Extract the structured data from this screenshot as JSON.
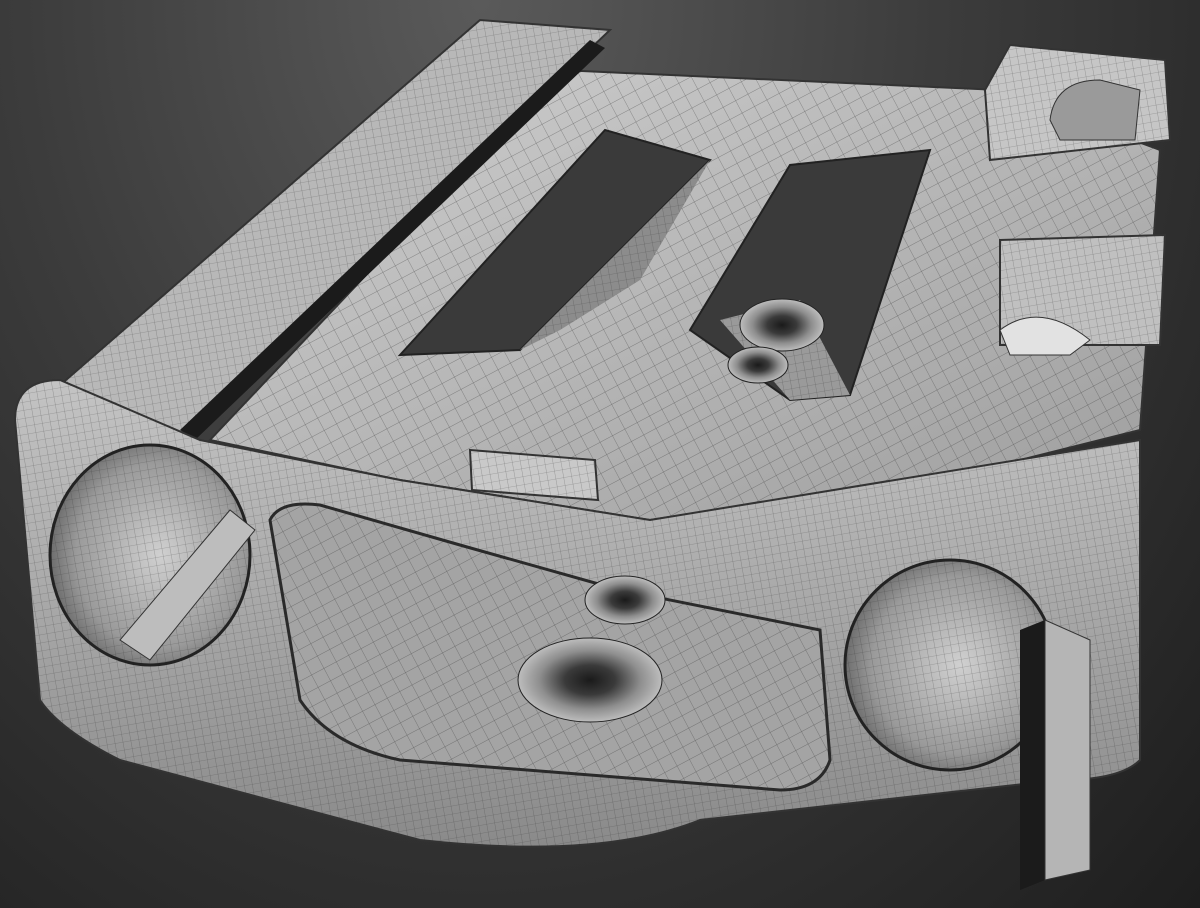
{
  "scene": {
    "subject": "",
    "colors": {
      "background_top": "#555555",
      "background_bottom": "#1c1c1c",
      "surface_light": "#d8d8d8",
      "surface_mid": "#a9a9a9",
      "surface_dark": "#6a6a6a",
      "wire": "#2a2a2a",
      "hole": "#1a1a1a"
    },
    "features": [
      "top-plate",
      "left-rail-groove",
      "center-window-left",
      "center-window-right",
      "front-left-bore",
      "front-right-bore",
      "front-pocket",
      "countersunk-hole-large",
      "countersunk-hole-small",
      "rear-right-clip",
      "side-right-clip",
      "front-tab"
    ]
  }
}
